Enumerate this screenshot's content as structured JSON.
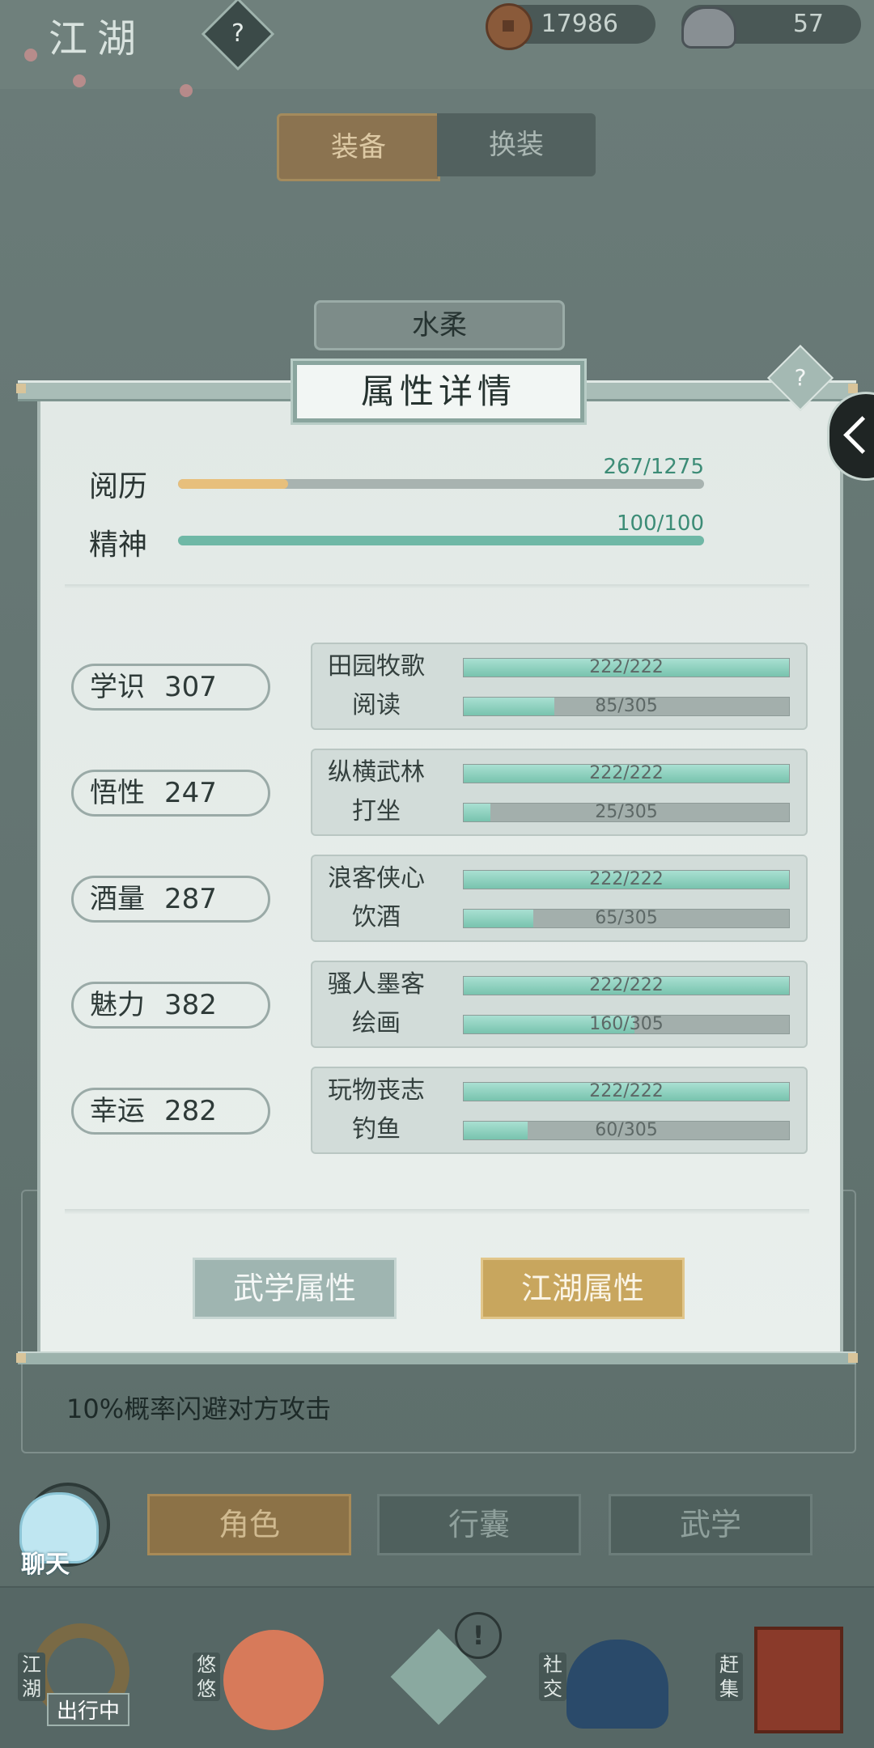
{
  "header": {
    "title": "江湖",
    "help_icon": "?",
    "copper": "17986",
    "silver": "57"
  },
  "tabs": {
    "equip": "装备",
    "change": "换装"
  },
  "character_name": "水柔",
  "panel": {
    "title": "属性详情",
    "help_icon": "?",
    "experience": {
      "label": "阅历",
      "value": "267/1275",
      "fraction": 0.209
    },
    "spirit": {
      "label": "精神",
      "value": "100/100",
      "fraction": 1.0
    },
    "stats": [
      {
        "name": "学识",
        "value": "307",
        "skills": [
          {
            "name": "田园牧歌",
            "value": "222/222",
            "fraction": 1.0
          },
          {
            "name": "阅读",
            "value": "85/305",
            "fraction": 0.279
          }
        ]
      },
      {
        "name": "悟性",
        "value": "247",
        "skills": [
          {
            "name": "纵横武林",
            "value": "222/222",
            "fraction": 1.0
          },
          {
            "name": "打坐",
            "value": "25/305",
            "fraction": 0.082
          }
        ]
      },
      {
        "name": "酒量",
        "value": "287",
        "skills": [
          {
            "name": "浪客侠心",
            "value": "222/222",
            "fraction": 1.0
          },
          {
            "name": "饮酒",
            "value": "65/305",
            "fraction": 0.213
          }
        ]
      },
      {
        "name": "魅力",
        "value": "382",
        "skills": [
          {
            "name": "骚人墨客",
            "value": "222/222",
            "fraction": 1.0
          },
          {
            "name": "绘画",
            "value": "160/305",
            "fraction": 0.525
          }
        ]
      },
      {
        "name": "幸运",
        "value": "282",
        "skills": [
          {
            "name": "玩物丧志",
            "value": "222/222",
            "fraction": 1.0
          },
          {
            "name": "钓鱼",
            "value": "60/305",
            "fraction": 0.197
          }
        ]
      }
    ],
    "martial_button": "武学属性",
    "jianghu_button": "江湖属性"
  },
  "under_text": "10%概率闪避对方攻击",
  "nav": {
    "role": "角色",
    "bag": "行囊",
    "kungfu": "武学",
    "chat": "聊天"
  },
  "dock": {
    "jianghu": "江湖",
    "travel": "出行中",
    "youyou": "悠悠",
    "social": "社交",
    "market": "赶集",
    "alert": "!"
  },
  "colors": {
    "exp_fill": "#e7bf7c",
    "spirit_fill": "#6fb8a6",
    "skill_fill": "#8ed0bf",
    "gold_button": "#c8a65e"
  }
}
